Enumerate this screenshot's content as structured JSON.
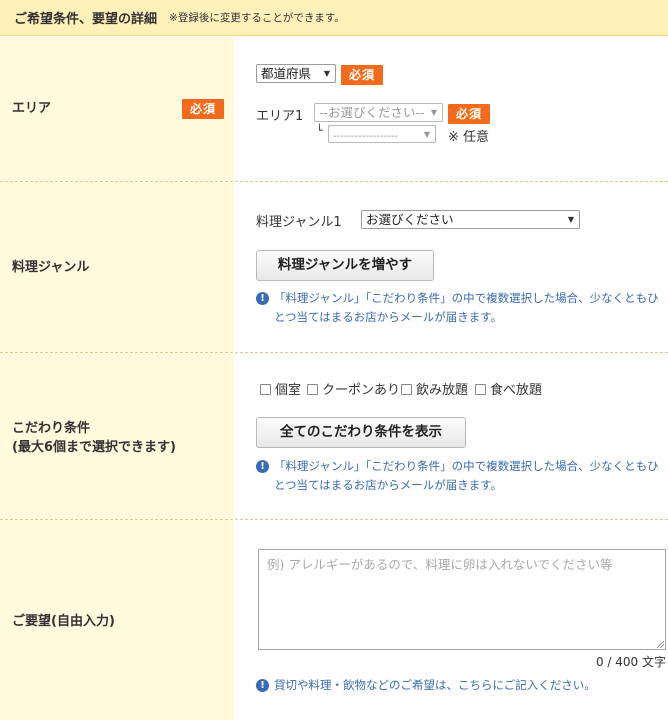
{
  "header": {
    "title": "ご希望条件、要望の詳細",
    "note": "※登録後に変更することができます。"
  },
  "required_label": "必須",
  "area": {
    "label": "エリア",
    "prefecture_select": "都道府県",
    "area1_label": "エリア1",
    "area1_select": "--お選びください--",
    "sub_branch": "└",
    "sub_select": "------------------",
    "optional_note": "※ 任意"
  },
  "genre": {
    "label": "料理ジャンル",
    "genre1_label": "料理ジャンル1",
    "genre1_select": "お選びください",
    "add_button": "料理ジャンルを増やす",
    "info": "「料理ジャンル」「こだわり条件」の中で複数選択した場合、少なくともひとつ当てはまるお店からメールが届きます。"
  },
  "kodawari": {
    "label_line1": "こだわり条件",
    "label_line2": "(最大6個まで選択できます)",
    "options": [
      "個室",
      "クーポンあり",
      "飲み放題",
      "食べ放題"
    ],
    "show_all_button": "全てのこだわり条件を表示",
    "info": "「料理ジャンル」「こだわり条件」の中で複数選択した場合、少なくともひとつ当てはまるお店からメールが届きます。"
  },
  "request": {
    "label": "ご要望(自由入力)",
    "placeholder": "例) アレルギーがあるので、料理に卵は入れないでください等",
    "counter": "0 / 400 文字",
    "info": "貸切や料理・飲物などのご希望は、こちらにご記入ください。"
  },
  "colors": {
    "required_bg": "#f26a1b",
    "info_text": "#3a6cb3",
    "header_bg": "#fdf0b9",
    "label_col_bg": "#fff9dd"
  }
}
